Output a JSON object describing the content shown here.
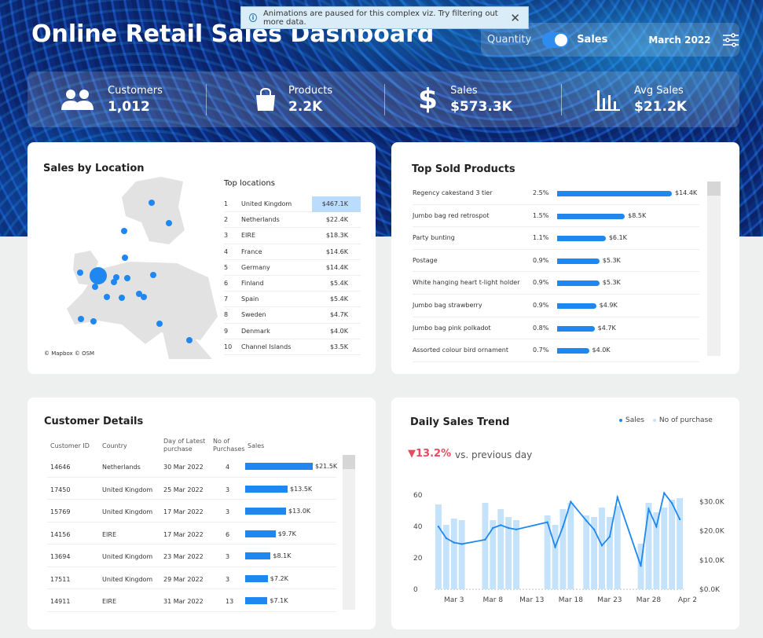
{
  "title": "Online Retail Sales Dashboard",
  "notice": {
    "text": "Animations are paused for this complex viz. Try filtering out more data."
  },
  "controls": {
    "quantity_label": "Quantity",
    "sales_label": "Sales",
    "month": "March 2022",
    "toggle_on": "Sales"
  },
  "kpis": [
    {
      "label": "Customers",
      "value": "1,012",
      "icon": "people-icon"
    },
    {
      "label": "Products",
      "value": "2.2K",
      "icon": "shopping-bag-icon"
    },
    {
      "label": "Sales",
      "value": "$573.3K",
      "icon": "dollar-icon"
    },
    {
      "label": "Avg Sales",
      "value": "$21.2K",
      "icon": "bar-chart-icon"
    }
  ],
  "location": {
    "title": "Sales by Location",
    "credit": "© Mapbox © OSM",
    "table_header": "Top locations",
    "rows": [
      {
        "rank": "1",
        "country": "United Kingdom",
        "sales": "$467.1K"
      },
      {
        "rank": "2",
        "country": "Netherlands",
        "sales": "$22.4K"
      },
      {
        "rank": "3",
        "country": "EIRE",
        "sales": "$18.3K"
      },
      {
        "rank": "4",
        "country": "France",
        "sales": "$14.6K"
      },
      {
        "rank": "5",
        "country": "Germany",
        "sales": "$14.4K"
      },
      {
        "rank": "6",
        "country": "Finland",
        "sales": "$5.4K"
      },
      {
        "rank": "7",
        "country": "Spain",
        "sales": "$5.4K"
      },
      {
        "rank": "8",
        "country": "Sweden",
        "sales": "$4.7K"
      },
      {
        "rank": "9",
        "country": "Denmark",
        "sales": "$4.0K"
      },
      {
        "rank": "10",
        "country": "Channel Islands",
        "sales": "$3.5K"
      }
    ]
  },
  "products": {
    "title": "Top Sold Products",
    "rows": [
      {
        "name": "Regency cakestand 3 tier",
        "pct": "2.5%",
        "sales": "$14.4K",
        "value": 14.4
      },
      {
        "name": "Jumbo bag red retrospot",
        "pct": "1.5%",
        "sales": "$8.5K",
        "value": 8.5
      },
      {
        "name": "Party bunting",
        "pct": "1.1%",
        "sales": "$6.1K",
        "value": 6.1
      },
      {
        "name": "Postage",
        "pct": "0.9%",
        "sales": "$5.3K",
        "value": 5.3
      },
      {
        "name": "White hanging heart t-light holder",
        "pct": "0.9%",
        "sales": "$5.3K",
        "value": 5.3
      },
      {
        "name": "Jumbo bag strawberry",
        "pct": "0.9%",
        "sales": "$4.9K",
        "value": 4.9
      },
      {
        "name": "Jumbo bag pink polkadot",
        "pct": "0.8%",
        "sales": "$4.7K",
        "value": 4.7
      },
      {
        "name": "Assorted colour bird ornament",
        "pct": "0.7%",
        "sales": "$4.0K",
        "value": 4.0
      }
    ]
  },
  "customers": {
    "title": "Customer Details",
    "headers": {
      "id": "Customer ID",
      "country": "Country",
      "day": "Day of Latest purchase",
      "count": "No of Purchases",
      "sales": "Sales"
    },
    "rows": [
      {
        "id": "14646",
        "country": "Netherlands",
        "day": "30 Mar 2022",
        "count": "4",
        "sales": "$21.5K",
        "value": 21.5
      },
      {
        "id": "17450",
        "country": "United Kingdom",
        "day": "25 Mar 2022",
        "count": "3",
        "sales": "$13.5K",
        "value": 13.5
      },
      {
        "id": "15769",
        "country": "United Kingdom",
        "day": "17 Mar 2022",
        "count": "3",
        "sales": "$13.0K",
        "value": 13.0
      },
      {
        "id": "14156",
        "country": "EIRE",
        "day": "17 Mar 2022",
        "count": "6",
        "sales": "$9.7K",
        "value": 9.7
      },
      {
        "id": "13694",
        "country": "United Kingdom",
        "day": "23 Mar 2022",
        "count": "3",
        "sales": "$8.1K",
        "value": 8.1
      },
      {
        "id": "17511",
        "country": "United Kingdom",
        "day": "29 Mar 2022",
        "count": "3",
        "sales": "$7.2K",
        "value": 7.2
      },
      {
        "id": "14911",
        "country": "EIRE",
        "day": "31 Mar 2022",
        "count": "13",
        "sales": "$7.1K",
        "value": 7.1
      }
    ]
  },
  "trend": {
    "title": "Daily Sales Trend",
    "delta": "▼13.2%",
    "delta_text": "vs. previous day",
    "legend": {
      "sales": "Sales",
      "purchases": "No of purchase"
    }
  },
  "chart_data": {
    "type": "bar",
    "title": "Daily Sales Trend",
    "x": [
      "Mar 1",
      "Mar 2",
      "Mar 3",
      "Mar 4",
      "Mar 5",
      "Mar 6",
      "Mar 7",
      "Mar 8",
      "Mar 9",
      "Mar 10",
      "Mar 11",
      "Mar 12",
      "Mar 13",
      "Mar 14",
      "Mar 15",
      "Mar 16",
      "Mar 17",
      "Mar 18",
      "Mar 19",
      "Mar 20",
      "Mar 21",
      "Mar 22",
      "Mar 23",
      "Mar 24",
      "Mar 25",
      "Mar 26",
      "Mar 27",
      "Mar 28",
      "Mar 29",
      "Mar 30",
      "Mar 31",
      "Apr 1"
    ],
    "tick_labels": [
      "Mar 3",
      "Mar 8",
      "Mar 13",
      "Mar 18",
      "Mar 23",
      "Mar 28",
      "Apr 2"
    ],
    "series": [
      {
        "name": "No of purchase",
        "type": "bar",
        "axis": "left",
        "values": [
          54,
          41,
          45,
          44,
          0,
          0,
          55,
          44,
          51,
          46,
          44,
          0,
          0,
          0,
          47,
          41,
          51,
          55,
          0,
          47,
          46,
          52,
          46,
          53,
          0,
          0,
          29,
          55,
          49,
          52,
          57,
          58
        ]
      },
      {
        "name": "Sales",
        "type": "line",
        "axis": "right",
        "values": [
          21.5,
          17.5,
          16,
          15.5,
          0,
          0,
          17,
          21,
          22,
          21,
          20.5,
          0,
          0,
          0,
          23,
          14.5,
          21.5,
          30,
          0,
          23.5,
          20.5,
          15,
          18,
          31.5,
          0,
          0,
          8,
          27.5,
          21.5,
          33,
          29.5,
          24
        ]
      }
    ],
    "ylim_left": [
      0,
      65
    ],
    "yticks_left": [
      "0",
      "20",
      "40",
      "60"
    ],
    "ylim_right": [
      0,
      35
    ],
    "yticks_right": [
      "$0.0K",
      "$10.0K",
      "$20.0K",
      "$30.0K"
    ]
  }
}
